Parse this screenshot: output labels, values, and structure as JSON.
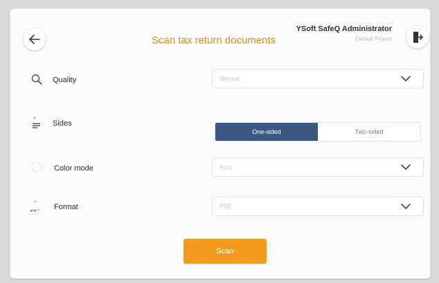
{
  "header": {
    "title": "Scan tax return documents",
    "user_name": "YSoft SafeQ Administrator",
    "project": "Default Project"
  },
  "settings": {
    "quality": {
      "label": "Quality",
      "value": "Normal"
    },
    "sides": {
      "label": "Sides",
      "options": [
        "One-sided",
        "Two-sided"
      ],
      "selected": "One-sided"
    },
    "color_mode": {
      "label": "Color mode",
      "value": "Auto"
    },
    "format": {
      "label": "Format",
      "value": "PDF"
    }
  },
  "actions": {
    "scan_label": "Scan"
  },
  "colors": {
    "accent": "#e08a1f",
    "button": "#f39b1c",
    "selected_toggle": "#3a5882"
  },
  "icons": [
    "back-arrow-icon",
    "logout-icon",
    "search-icon",
    "sides-icon",
    "color-mode-icon",
    "format-icon",
    "chevron-down-icon"
  ]
}
